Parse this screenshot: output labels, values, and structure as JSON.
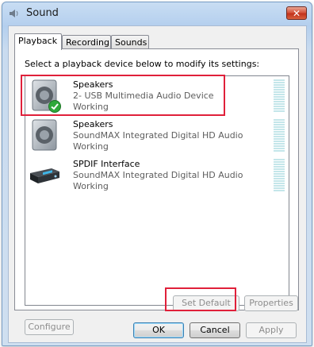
{
  "window": {
    "title": "Sound",
    "close_glyph": "✕"
  },
  "tabs": [
    {
      "label": "Playback",
      "active": true
    },
    {
      "label": "Recording",
      "active": false
    },
    {
      "label": "Sounds",
      "active": false
    }
  ],
  "instruction": "Select a playback device below to modify its settings:",
  "devices": [
    {
      "name": "Speakers",
      "description": "2- USB Multimedia Audio Device",
      "status": "Working",
      "icon": "speaker-icon",
      "is_default": true
    },
    {
      "name": "Speakers",
      "description": "SoundMAX Integrated Digital HD Audio",
      "status": "Working",
      "icon": "speaker-icon",
      "is_default": false
    },
    {
      "name": "SPDIF Interface",
      "description": "SoundMAX Integrated Digital HD Audio",
      "status": "Working",
      "icon": "spdif-receiver-icon",
      "is_default": false
    }
  ],
  "buttons": {
    "configure": "Configure",
    "set_default": "Set Default",
    "properties": "Properties",
    "ok": "OK",
    "cancel": "Cancel",
    "apply": "Apply"
  },
  "colors": {
    "highlight": "#e0203a",
    "close_button": "#c2331c"
  }
}
